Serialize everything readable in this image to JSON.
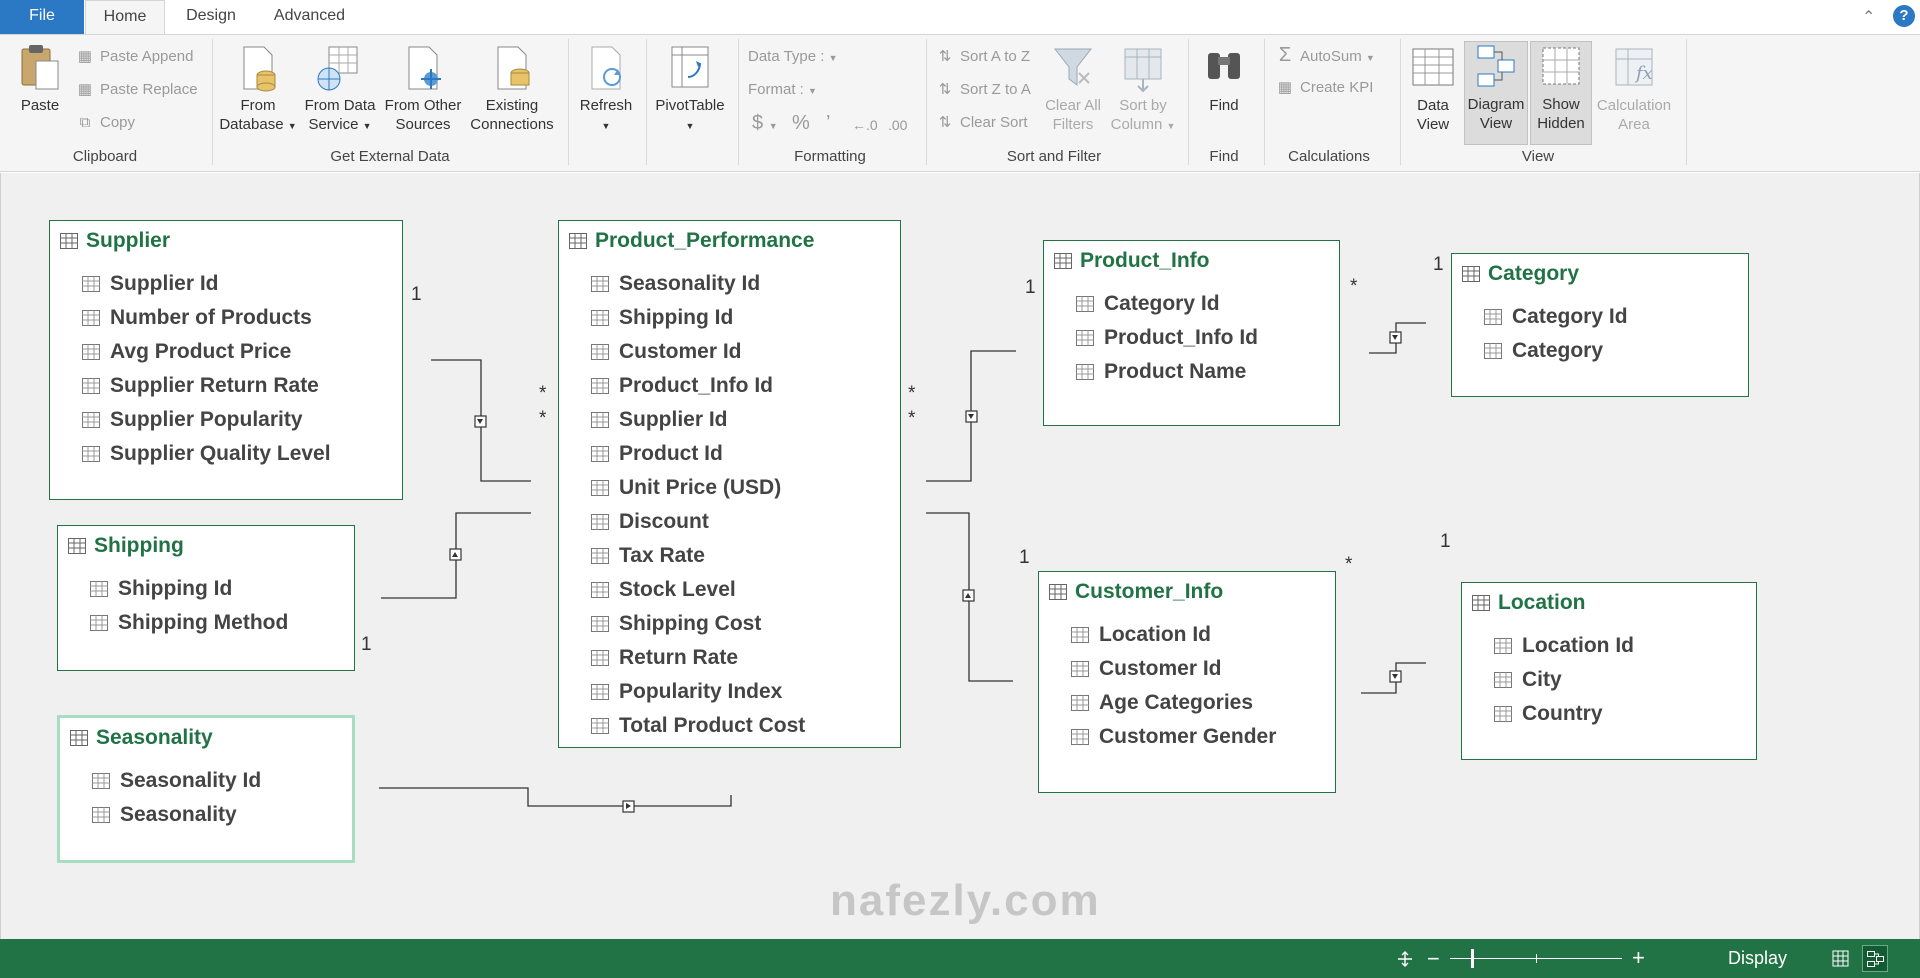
{
  "tabs": {
    "file": "File",
    "home": "Home",
    "design": "Design",
    "advanced": "Advanced"
  },
  "ribbon": {
    "clipboard": {
      "label": "Clipboard",
      "paste": "Paste",
      "paste_append": "Paste Append",
      "paste_replace": "Paste Replace",
      "copy": "Copy"
    },
    "external": {
      "label": "Get External Data",
      "from_database": [
        "From",
        "Database"
      ],
      "from_data_service": [
        "From Data",
        "Service"
      ],
      "from_other_sources": [
        "From Other",
        "Sources"
      ],
      "existing_connections": [
        "Existing",
        "Connections"
      ]
    },
    "refresh": "Refresh",
    "pivot": "PivotTable",
    "formatting": {
      "label": "Formatting",
      "data_type": "Data Type :",
      "format": "Format :",
      "currency": "$",
      "percent": "%",
      "comma": "’",
      "inc_decimal": "←.0",
      "dec_decimal": ".00"
    },
    "sort": {
      "label": "Sort and Filter",
      "sort_az": "Sort A to Z",
      "sort_za": "Sort Z to A",
      "clear_sort": "Clear Sort",
      "clear_filters": [
        "Clear All",
        "Filters"
      ],
      "sort_by_column": [
        "Sort by",
        "Column"
      ]
    },
    "find": {
      "label": "Find",
      "button": "Find"
    },
    "calculations": {
      "label": "Calculations",
      "autosum": "AutoSum",
      "create_kpi": "Create KPI"
    },
    "view": {
      "label": "View",
      "data_view": [
        "Data",
        "View"
      ],
      "diagram_view": [
        "Diagram",
        "View"
      ],
      "show_hidden": [
        "Show",
        "Hidden"
      ],
      "calc_area": [
        "Calculation",
        "Area"
      ]
    }
  },
  "tables": {
    "supplier": {
      "title": "Supplier",
      "columns": [
        "Supplier Id",
        "Number of Products",
        "Avg Product Price",
        "Supplier Return Rate",
        "Supplier Popularity",
        "Supplier Quality Level"
      ]
    },
    "shipping": {
      "title": "Shipping",
      "columns": [
        "Shipping Id",
        "Shipping Method"
      ]
    },
    "seasonality": {
      "title": "Seasonality",
      "columns": [
        "Seasonality Id",
        "Seasonality"
      ]
    },
    "product_performance": {
      "title": "Product_Performance",
      "columns": [
        "Seasonality Id",
        "Shipping Id",
        "Customer Id",
        "Product_Info Id",
        "Supplier Id",
        "Product Id",
        "Unit Price (USD)",
        "Discount",
        "Tax Rate",
        "Stock Level",
        "Shipping Cost",
        "Return Rate",
        "Popularity Index",
        "Total Product Cost"
      ]
    },
    "product_info": {
      "title": "Product_Info",
      "columns": [
        "Category Id",
        "Product_Info Id",
        "Product Name"
      ]
    },
    "category": {
      "title": "Category",
      "columns": [
        "Category Id",
        "Category"
      ]
    },
    "customer_info": {
      "title": "Customer_Info",
      "columns": [
        "Location Id",
        "Customer Id",
        "Age Categories",
        "Customer Gender"
      ]
    },
    "location": {
      "title": "Location",
      "columns": [
        "Location Id",
        "City",
        "Country"
      ]
    }
  },
  "cardinality": {
    "one": "1",
    "many": "*"
  },
  "statusbar": {
    "display": "Display",
    "minus": "−",
    "plus": "+"
  },
  "watermark": "nafezly.com"
}
